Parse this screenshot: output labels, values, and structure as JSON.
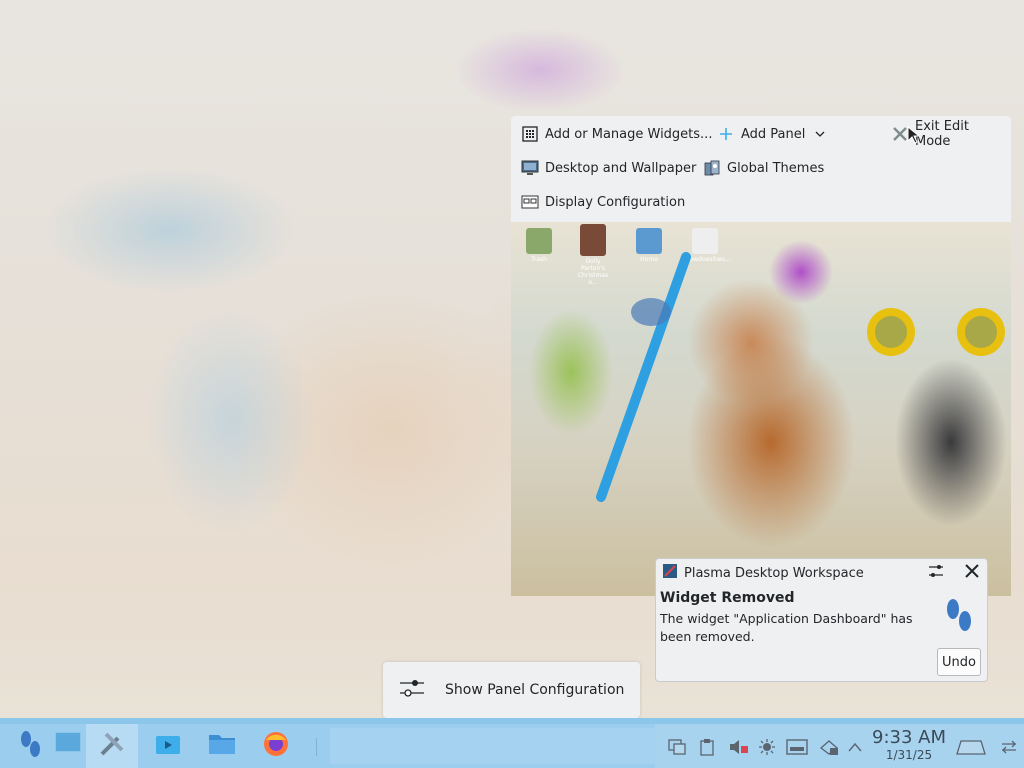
{
  "toolbar": {
    "add_widgets": "Add or Manage Widgets...",
    "add_panel": "Add Panel",
    "exit_edit": "Exit Edit Mode",
    "desktop_wallpaper": "Desktop and Wallpaper",
    "global_themes": "Global Themes",
    "display_config": "Display Configuration"
  },
  "preview": {
    "icons": [
      {
        "label": "Trash"
      },
      {
        "label": "Dolly Parton's Christmas o..."
      },
      {
        "label": "Home"
      },
      {
        "label": "Howdoesitwo..."
      }
    ]
  },
  "notification": {
    "app": "Plasma Desktop Workspace",
    "title": "Widget Removed",
    "body": "The widget \"Application Dashboard\" has been removed.",
    "undo": "Undo"
  },
  "panel_config": {
    "label": "Show Panel Configuration"
  },
  "clock": {
    "time": "9:33 AM",
    "date": "1/31/25"
  },
  "colors": {
    "panel": "#9bcdee",
    "accent": "#3daee9"
  }
}
